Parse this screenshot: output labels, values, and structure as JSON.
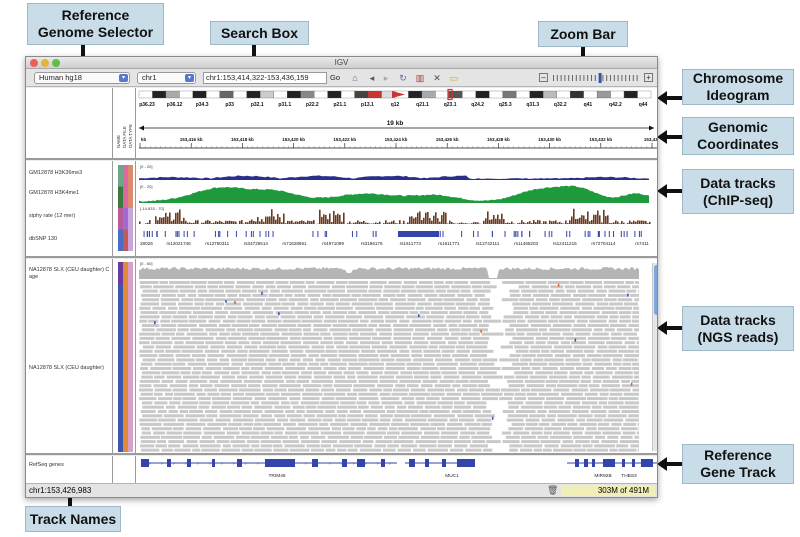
{
  "callouts": {
    "genome_selector": "Reference\nGenome Selector",
    "search_box": "Search Box",
    "zoom_bar": "Zoom Bar",
    "chromosome_ideogram": "Chromosome\nIdeogram",
    "genomic_coordinates": "Genomic\nCoordinates",
    "chipseq_tracks": "Data tracks\n(ChIP-seq)",
    "ngs_tracks": "Data tracks\n(NGS reads)",
    "gene_track": "Reference\nGene Track",
    "track_names": "Track Names"
  },
  "window": {
    "title": "IGV"
  },
  "toolbar": {
    "genome": "Human hg18",
    "chromosome": "chr1",
    "locus": "chr1:153,414,322-153,436,159",
    "go_label": "Go",
    "icons": [
      "home-icon",
      "back-icon",
      "forward-icon",
      "refresh-icon",
      "region-icon",
      "close-icon",
      "popup-icon"
    ]
  },
  "attribute_headers": [
    "NAME",
    "DATA FILE",
    "DATA TYPE"
  ],
  "ideogram": {
    "bands": [
      "p36.23",
      "p36.12",
      "p34.3",
      "p33",
      "p32.1",
      "p31.1",
      "p22.2",
      "p21.1",
      "p13.1",
      "q12",
      "q21.1",
      "q23.1",
      "q24.2",
      "q25.3",
      "q31.3",
      "q32.2",
      "q41",
      "q42.2",
      "q44"
    ]
  },
  "ruler": {
    "span_label": "19 kb",
    "ticks": [
      "kb",
      "153,416 kb",
      "153,418 kb",
      "153,420 kb",
      "153,422 kb",
      "153,424 kb",
      "153,426 kb",
      "153,428 kb",
      "153,430 kb",
      "153,432 kb",
      "153,434"
    ]
  },
  "chip_tracks": [
    {
      "name": "GM12878 H3K36me3",
      "range": "[0 - 20]",
      "color": "#2a2f8a"
    },
    {
      "name": "GM12878 H3K4me1",
      "range": "[0 - 20]",
      "color": "#1e9a3c"
    },
    {
      "name": "siphy rate (12 mer)",
      "range": "[-14.833 - 70]",
      "color": "#6b3a1c"
    },
    {
      "name": "dbSNP 130",
      "range": "",
      "color": "#3344aa"
    }
  ],
  "snp_ids": [
    "28026",
    "rs12021746",
    "rs12750311",
    "rs34725514",
    "rs71628651",
    "rs4971099",
    "rs3186176",
    "rs1611773",
    "rs1611771",
    "rs12742111",
    "rs11465203",
    "rs12411216",
    "rs72704114",
    "rs7411"
  ],
  "ngs_track": {
    "coverage_name": "NA12878 SLX (CEU daughter) C",
    "coverage_name_2": "age",
    "coverage_range": "[0 - 60]",
    "reads_name": "NA12878 SLX (CEU daughter)"
  },
  "gene_track": {
    "name": "RefSeq genes",
    "genes": [
      "TRIM46",
      "MUC1",
      "MIR92B",
      "THBS3"
    ]
  },
  "status": {
    "locus": "chr1:153,426,983",
    "memory": "303M of 491M"
  }
}
